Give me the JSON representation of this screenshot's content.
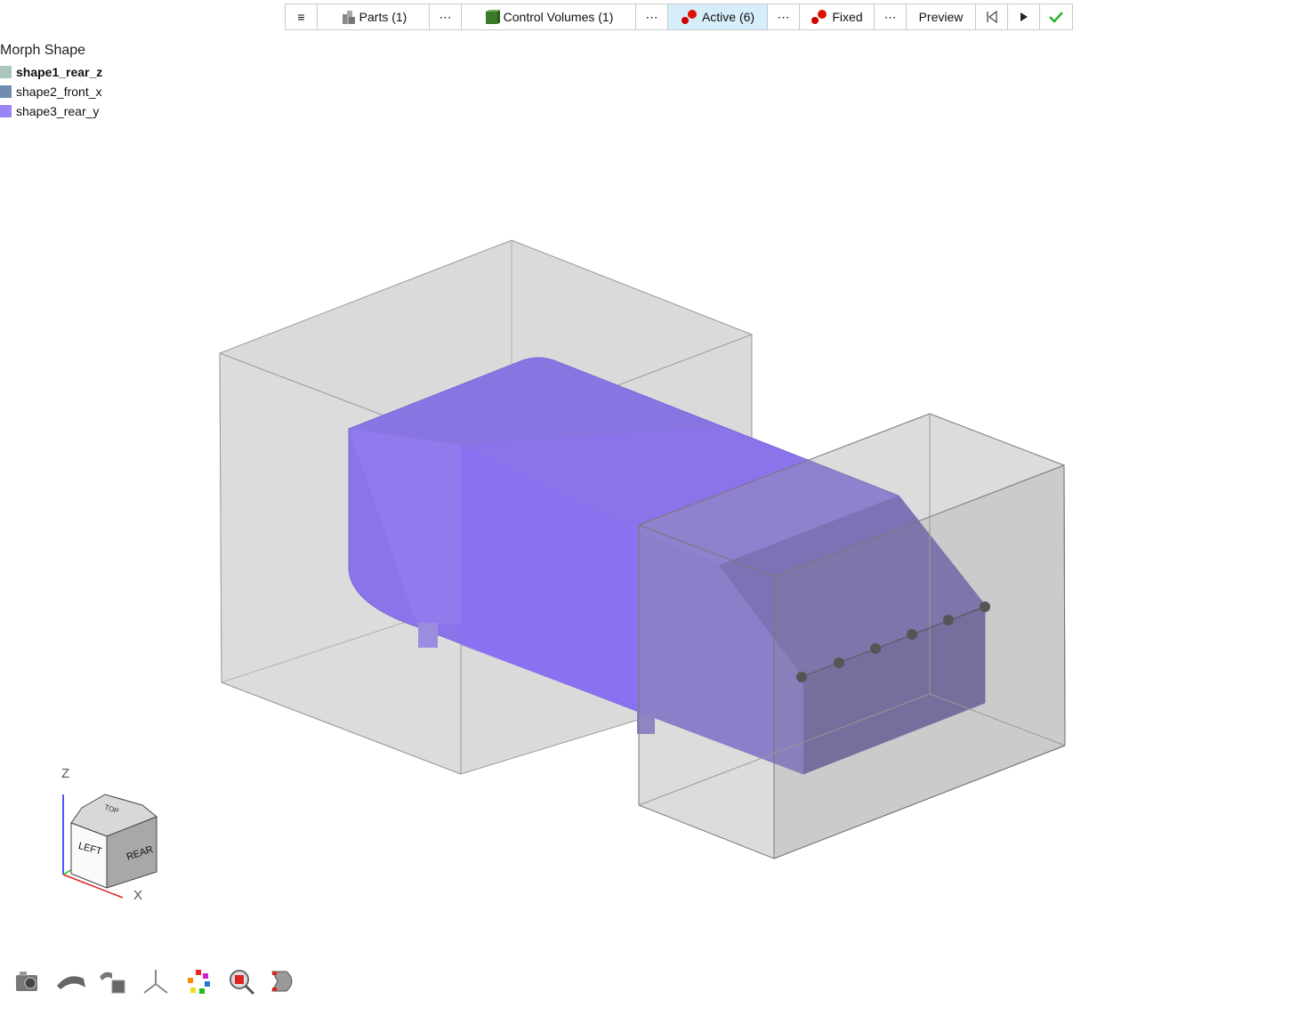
{
  "toolbar": {
    "menu_icon": "hamburger-menu-icon",
    "parts_label": "Parts (1)",
    "more_label": "⋯",
    "control_volumes_label": "Control Volumes (1)",
    "active_label": "Active (6)",
    "fixed_label": "Fixed",
    "preview_label": "Preview",
    "active_selected": true,
    "colors": {
      "active_bg": "#d6eefa",
      "check": "#2db52d"
    }
  },
  "legend": {
    "title": "Morph Shape",
    "items": [
      {
        "label": "shape1_rear_z",
        "color": "#a9c7bd",
        "bold": true
      },
      {
        "label": "shape2_front_x",
        "color": "#6e8bb0",
        "bold": false
      },
      {
        "label": "shape3_rear_y",
        "color": "#9b85f5",
        "bold": false
      }
    ]
  },
  "viewcube": {
    "top": "TOP",
    "left": "LEFT",
    "rear": "REAR",
    "axis_z": "Z",
    "axis_x": "X"
  },
  "bottom_tools": [
    "camera-icon",
    "surface-icon",
    "surface-to-solid-icon",
    "axis-triad-icon",
    "color-wheel-icon",
    "inspect-zoom-icon",
    "part-view-icon"
  ]
}
